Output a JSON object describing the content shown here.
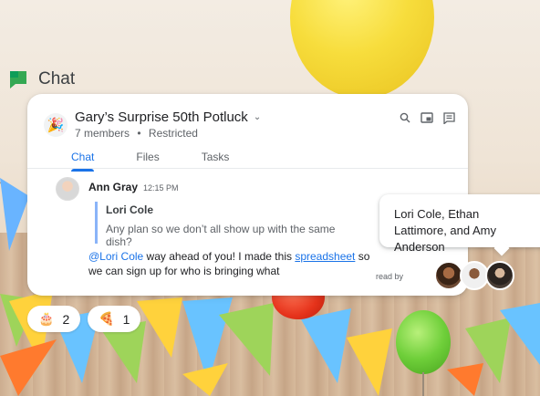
{
  "app": {
    "title": "Chat",
    "logo_icon": "google-chat-icon",
    "accent": "#1a73e8"
  },
  "room": {
    "emoji": "🎉",
    "title": "Gary’s Surprise 50th Potluck",
    "members": "7 members",
    "status": "Restricted",
    "separator": "•"
  },
  "toolbar": {
    "icons": [
      "search-icon",
      "pip-icon",
      "thread-icon"
    ]
  },
  "tabs": [
    {
      "label": "Chat",
      "active": true
    },
    {
      "label": "Files",
      "active": false
    },
    {
      "label": "Tasks",
      "active": false
    }
  ],
  "message": {
    "author": "Ann Gray",
    "time": "12:15 PM",
    "quote": {
      "author": "Lori Cole",
      "text": "Any plan so we don’t all show up with the same dish?"
    },
    "body_mention": "@Lori Cole",
    "body_1": " way ahead of you! I made this ",
    "body_link": "spreadsheet",
    "body_2": " so we can sign up for who is bringing what"
  },
  "read_by": {
    "label": "read by",
    "tooltip": "Lori Cole, Ethan Lattimore, and Amy Anderson"
  },
  "reactions": [
    {
      "emoji": "🎂",
      "count": "2"
    },
    {
      "emoji": "🍕",
      "count": "1"
    }
  ]
}
